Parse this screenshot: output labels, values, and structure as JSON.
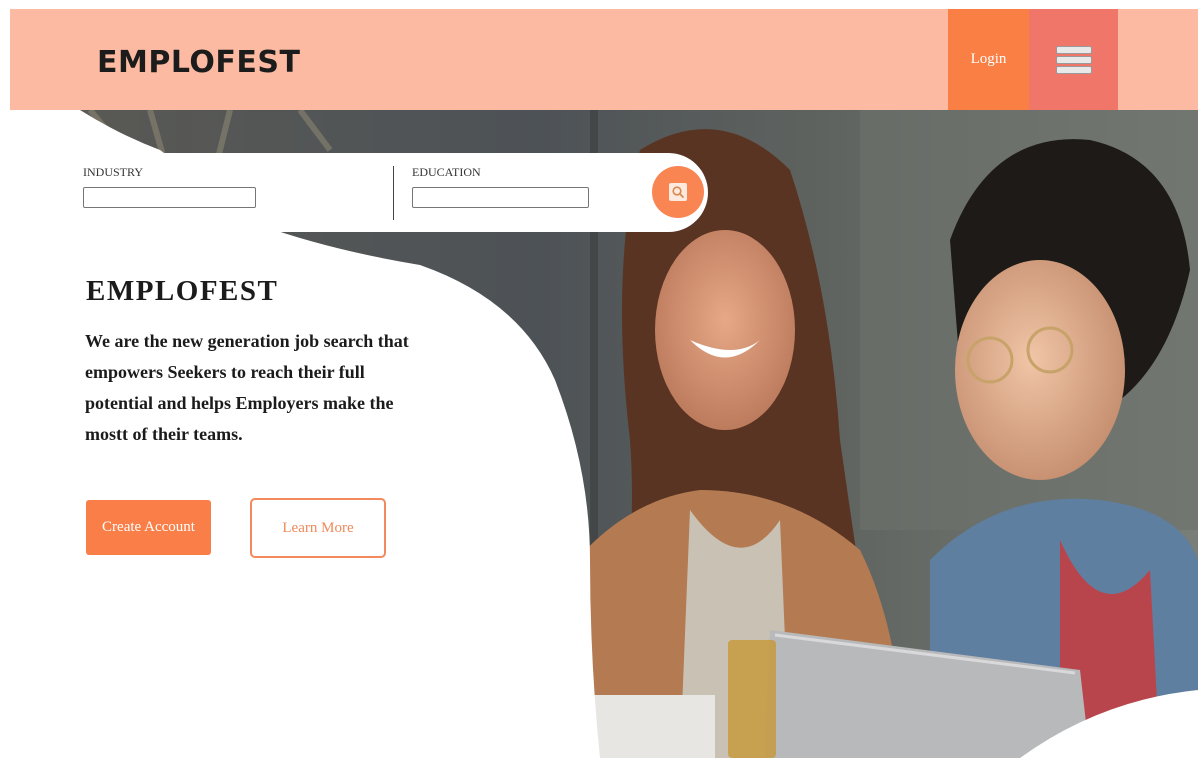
{
  "header": {
    "brand": "EMPLOFEST",
    "login_label": "Login",
    "menu_icon": "hamburger-menu-icon"
  },
  "search": {
    "industry_label": "INDUSTRY",
    "industry_value": "",
    "education_label": "EDUCATION",
    "education_value": "",
    "search_icon": "search-icon"
  },
  "hero": {
    "title": "EMPLOFEST",
    "description": "We are the new generation job search that empowers Seekers to reach their full potential and helps Employers make the mostt of their teams.",
    "create_account_label": "Create Account",
    "learn_more_label": "Learn More"
  },
  "colors": {
    "header_bg": "#fbbaa1",
    "accent": "#fa7f45",
    "menu_bg": "#f0766a"
  }
}
